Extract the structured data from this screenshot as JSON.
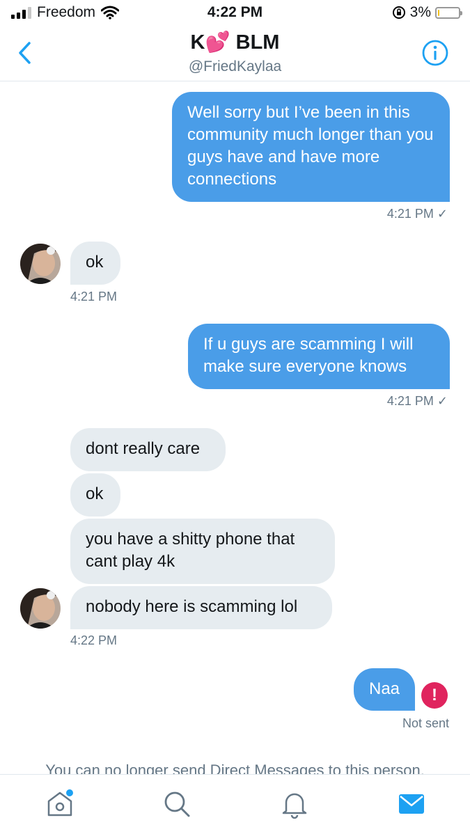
{
  "status_bar": {
    "carrier": "Freedom",
    "time": "4:22 PM",
    "battery": "3%",
    "battery_level": 0.03
  },
  "header": {
    "name": "K💕 BLM",
    "handle": "@FriedKaylaa"
  },
  "messages": [
    {
      "dir": "out",
      "text": "Well sorry but I’ve been in this community much longer than you guys have and have more connections"
    },
    {
      "dir": "out_meta",
      "text": "4:21 PM ✓"
    },
    {
      "dir": "in",
      "text": "ok"
    },
    {
      "dir": "in_meta",
      "text": "4:21 PM"
    },
    {
      "dir": "out",
      "text": "If u guys are scamming I will make sure everyone knows"
    },
    {
      "dir": "out_meta",
      "text": "4:21 PM ✓"
    },
    {
      "dir": "in",
      "text": "dont really care"
    },
    {
      "dir": "in",
      "text": "ok"
    },
    {
      "dir": "in",
      "text": "you have a shitty phone that cant play 4k"
    },
    {
      "dir": "in",
      "text": "nobody here is scamming lol"
    },
    {
      "dir": "in_meta",
      "text": "4:22 PM"
    },
    {
      "dir": "out",
      "text": "Naa"
    },
    {
      "dir": "out_meta",
      "text": "Not sent"
    }
  ],
  "error_icon": "!",
  "notice": "You can no longer send Direct Messages to this person.",
  "tabs": [
    {
      "name": "home-icon"
    },
    {
      "name": "search-icon"
    },
    {
      "name": "bell-icon"
    },
    {
      "name": "mail-icon"
    }
  ],
  "colors": {
    "accent": "#1da1f2",
    "outgoing_bubble": "#4a9de8",
    "incoming_bubble": "#e6ecf0",
    "error": "#e0245e"
  }
}
